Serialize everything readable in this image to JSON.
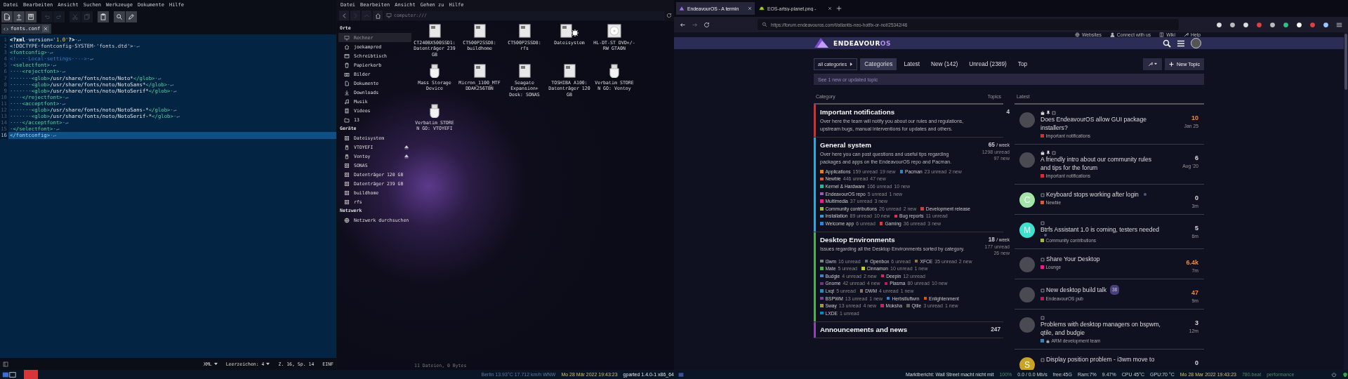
{
  "editor": {
    "menu": [
      "Datei",
      "Bearbeiten",
      "Ansicht",
      "Suchen",
      "Werkzeuge",
      "Dokumente",
      "Hilfe"
    ],
    "toolbar": [
      {
        "kind": "new",
        "disabled": false
      },
      {
        "kind": "open",
        "disabled": false
      },
      {
        "kind": "save",
        "disabled": false
      },
      {
        "kind": "undo",
        "disabled": true
      },
      {
        "kind": "redo",
        "disabled": true
      },
      {
        "kind": "cut",
        "disabled": true
      },
      {
        "kind": "copy",
        "disabled": true
      },
      {
        "kind": "paste",
        "disabled": false
      },
      {
        "kind": "search",
        "disabled": false
      },
      {
        "kind": "edit",
        "disabled": false
      }
    ],
    "tab": {
      "label": "fonts.conf"
    },
    "lines": [
      {
        "number": "1",
        "selected": false,
        "segments": [
          {
            "kind": "decl",
            "text": "<?xml"
          },
          {
            "kind": "ws",
            "text": "·"
          },
          {
            "kind": "text",
            "text": "version="
          },
          {
            "kind": "string",
            "text": "'1.0'"
          },
          {
            "kind": "decl",
            "text": "?>"
          },
          {
            "kind": "ws",
            "text": "·↵"
          }
        ]
      },
      {
        "number": "2",
        "selected": false,
        "segments": [
          {
            "kind": "doctype",
            "text": "<!DOCTYPE·fontconfig·SYSTEM·'fonts.dtd'>"
          },
          {
            "kind": "ws",
            "text": "·↵"
          }
        ]
      },
      {
        "number": "3",
        "selected": false,
        "segments": [
          {
            "kind": "tag",
            "text": "<fontconfig>"
          },
          {
            "kind": "ws",
            "text": "·↵"
          }
        ]
      },
      {
        "number": "4",
        "selected": false,
        "segments": [
          {
            "kind": "comment",
            "text": "<!--··Local·settings··-->"
          },
          {
            "kind": "ws",
            "text": "·↵"
          }
        ]
      },
      {
        "number": "5",
        "selected": false,
        "segments": [
          {
            "kind": "ws",
            "text": "·"
          },
          {
            "kind": "tag",
            "text": "<selectfont>"
          },
          {
            "kind": "ws",
            "text": "·↵"
          }
        ]
      },
      {
        "number": "6",
        "selected": false,
        "segments": [
          {
            "kind": "ws",
            "text": "····"
          },
          {
            "kind": "tag",
            "text": "<rejectfont>"
          },
          {
            "kind": "ws",
            "text": "·↵"
          }
        ]
      },
      {
        "number": "7",
        "selected": false,
        "segments": [
          {
            "kind": "ws",
            "text": "·······"
          },
          {
            "kind": "tag",
            "text": "<glob>"
          },
          {
            "kind": "text",
            "text": "/usr/share/fonts/noto/Noto*"
          },
          {
            "kind": "tag",
            "text": "</glob>"
          },
          {
            "kind": "ws",
            "text": "·↵"
          }
        ]
      },
      {
        "number": "8",
        "selected": false,
        "segments": [
          {
            "kind": "ws",
            "text": "·······"
          },
          {
            "kind": "tag",
            "text": "<glob>"
          },
          {
            "kind": "text",
            "text": "/usr/share/fonts/noto/NotoSans*"
          },
          {
            "kind": "tag",
            "text": "</glob>"
          },
          {
            "kind": "ws",
            "text": "·↵"
          }
        ]
      },
      {
        "number": "9",
        "selected": false,
        "segments": [
          {
            "kind": "ws",
            "text": "·······"
          },
          {
            "kind": "tag",
            "text": "<glob>"
          },
          {
            "kind": "text",
            "text": "/usr/share/fonts/noto/NotoSerif*"
          },
          {
            "kind": "tag",
            "text": "</glob>"
          },
          {
            "kind": "ws",
            "text": "·↵"
          }
        ]
      },
      {
        "number": "10",
        "selected": false,
        "segments": [
          {
            "kind": "ws",
            "text": "····"
          },
          {
            "kind": "tag",
            "text": "</rejectfont>"
          },
          {
            "kind": "ws",
            "text": "·↵"
          }
        ]
      },
      {
        "number": "11",
        "selected": false,
        "segments": [
          {
            "kind": "ws",
            "text": "····"
          },
          {
            "kind": "tag",
            "text": "<acceptfont>"
          },
          {
            "kind": "ws",
            "text": "·↵"
          }
        ]
      },
      {
        "number": "12",
        "selected": false,
        "segments": [
          {
            "kind": "ws",
            "text": "·······"
          },
          {
            "kind": "tag",
            "text": "<glob>"
          },
          {
            "kind": "text",
            "text": "/usr/share/fonts/noto/NotoSans-*"
          },
          {
            "kind": "tag",
            "text": "</glob>"
          },
          {
            "kind": "ws",
            "text": "·↵"
          }
        ]
      },
      {
        "number": "13",
        "selected": false,
        "segments": [
          {
            "kind": "ws",
            "text": "·······"
          },
          {
            "kind": "tag",
            "text": "<glob>"
          },
          {
            "kind": "text",
            "text": "/usr/share/fonts/noto/NotoSerif-*"
          },
          {
            "kind": "tag",
            "text": "</glob>"
          },
          {
            "kind": "ws",
            "text": "·↵"
          }
        ]
      },
      {
        "number": "14",
        "selected": false,
        "segments": [
          {
            "kind": "ws",
            "text": "····"
          },
          {
            "kind": "tag",
            "text": "</acceptfont>"
          },
          {
            "kind": "ws",
            "text": "·↵"
          }
        ]
      },
      {
        "number": "15",
        "selected": false,
        "segments": [
          {
            "kind": "ws",
            "text": "·"
          },
          {
            "kind": "tag",
            "text": "</selectfont>"
          },
          {
            "kind": "ws",
            "text": "·↵"
          }
        ]
      },
      {
        "number": "16",
        "selected": true,
        "segments": [
          {
            "kind": "tag",
            "text": "</fontconfig>"
          },
          {
            "kind": "ws",
            "text": "·↵"
          }
        ]
      }
    ],
    "status_bar": [
      {
        "kind": "dropdown",
        "text": "XML"
      },
      {
        "kind": "dropdown",
        "text": "Leerzeichen: 4"
      },
      {
        "kind": "text",
        "text": "Z. 16, Sp. 14"
      },
      {
        "kind": "text",
        "text": "EINF"
      }
    ]
  },
  "file_manager": {
    "menu": [
      "Datei",
      "Bearbeiten",
      "Ansicht",
      "Gehen zu",
      "Hilfe"
    ],
    "nav": [
      {
        "kind": "back",
        "disabled": false
      },
      {
        "kind": "forward",
        "disabled": true
      },
      {
        "kind": "up",
        "disabled": true
      },
      {
        "kind": "home",
        "disabled": false
      }
    ],
    "address": "computer:///",
    "sidebar": [
      {
        "title": "Orte",
        "items": [
          {
            "label": "Rechner",
            "kind": "computer",
            "selected": true,
            "ejectable": false
          },
          {
            "label": "joekampred",
            "kind": "home",
            "selected": false,
            "ejectable": false
          },
          {
            "label": "Schreibtisch",
            "kind": "desktop",
            "selected": false,
            "ejectable": false
          },
          {
            "label": "Papierkorb",
            "kind": "trash",
            "selected": false,
            "ejectable": false
          },
          {
            "label": "Bilder",
            "kind": "pictures",
            "selected": false,
            "ejectable": false
          },
          {
            "label": "Dokumente",
            "kind": "documents",
            "selected": false,
            "ejectable": false
          },
          {
            "label": "Downloads",
            "kind": "downloads",
            "selected": false,
            "ejectable": false
          },
          {
            "label": "Musik",
            "kind": "music",
            "selected": false,
            "ejectable": false
          },
          {
            "label": "Videos",
            "kind": "videos",
            "selected": false,
            "ejectable": false
          },
          {
            "label": "13",
            "kind": "folder",
            "selected": false,
            "ejectable": false
          }
        ]
      },
      {
        "title": "Geräte",
        "items": [
          {
            "label": "Dateisystem",
            "kind": "drive",
            "selected": false,
            "ejectable": false
          },
          {
            "label": "VTOYEFI",
            "kind": "usb",
            "selected": false,
            "ejectable": true
          },
          {
            "label": "Ventoy",
            "kind": "usb",
            "selected": false,
            "ejectable": true
          },
          {
            "label": "SONAS",
            "kind": "drive",
            "selected": false,
            "ejectable": false
          },
          {
            "label": "Datenträger 120 GB",
            "kind": "drive",
            "selected": false,
            "ejectable": false
          },
          {
            "label": "Datenträger 239 GB",
            "kind": "drive",
            "selected": false,
            "ejectable": false
          },
          {
            "label": "buildhome",
            "kind": "drive",
            "selected": false,
            "ejectable": false
          },
          {
            "label": "rfs",
            "kind": "drive",
            "selected": false,
            "ejectable": false
          }
        ]
      },
      {
        "title": "Netzwerk",
        "items": [
          {
            "label": "Netzwerk durchsuchen",
            "kind": "network",
            "selected": false,
            "ejectable": false
          }
        ]
      }
    ],
    "items": [
      {
        "label": "CT240BX500SSD1: Datenträger 239 GB",
        "kind": "drive"
      },
      {
        "label": "CT500P2SSD8: buildhome",
        "kind": "drive"
      },
      {
        "label": "CT500P2SSD8: rfs",
        "kind": "drive"
      },
      {
        "label": "Dateisystem",
        "kind": "filesystem"
      },
      {
        "label": "HL-DT-ST DVD+/-RW GTA0N",
        "kind": "optical"
      },
      {
        "label": "Mass Storage Device",
        "kind": "usb"
      },
      {
        "label": "Micron_1100_MTFDDAK256TBN",
        "kind": "drive"
      },
      {
        "label": "Seagate Expansion+ Desk: SONAS",
        "kind": "drive"
      },
      {
        "label": "TOSHIBA A100: Datenträger 120 GB",
        "kind": "drive"
      },
      {
        "label": "Verbatim STORE N GO: Ventoy",
        "kind": "usb"
      },
      {
        "label": "Verbatim STORE N GO: VTOYEFI",
        "kind": "usb"
      }
    ],
    "status_bar": "11 Dateien, 0 Bytes"
  },
  "browser": {
    "tabs": [
      {
        "title": "EndeavourOS - A termin",
        "kind": "forum",
        "selected": true
      },
      {
        "title": "EOS-artsy-planet.png -",
        "kind": "image",
        "selected": false
      }
    ],
    "url": "https://forum.endeavouros.com/t/atlantis-neo-hotfix-or-not/25342/46",
    "forum": {
      "top_links": [
        {
          "label": "Websites",
          "kind": "globe"
        },
        {
          "label": "Connect with us",
          "kind": "user"
        },
        {
          "label": "Wiki",
          "kind": "book"
        },
        {
          "label": "Help",
          "kind": "wrench"
        }
      ],
      "logo": {
        "text": "ENDEAVOUR",
        "accent": "OS"
      },
      "category_dropdown": "all categories",
      "nav": [
        {
          "label": "Categories",
          "selected": true
        },
        {
          "label": "Latest",
          "selected": false
        },
        {
          "label": "New (142)",
          "selected": false
        },
        {
          "label": "Unread (2389)",
          "selected": false
        },
        {
          "label": "Top",
          "selected": false
        }
      ],
      "new_topic": "New Topic",
      "banner": "See 1 new or updated topic",
      "category_heading": "Category",
      "topics_heading": "Topics",
      "latest_heading": "Latest",
      "categories": [
        {
          "name": "Important notifications",
          "color": "#d32f2f",
          "description": "Over here the team will notify you about our rules and regulations, upstream bugs, manual interventions for updates and others.",
          "count": "4"
        },
        {
          "name": "General system",
          "color": "#25aae2",
          "description": "Over here you can post questions and useful tips regarding packages and apps on the EndeavourOS repo and Pacman.",
          "count": "65",
          "period": "/ week",
          "unread": "1298 unread",
          "new": "97 new",
          "subcategories": [
            [
              {
                "name": "Applications",
                "color": "#e67e22",
                "unread": "159 unread",
                "new": "19 new"
              },
              {
                "name": "Pacman",
                "color": "#2e86c1",
                "unread": "23 unread",
                "new": "2 new"
              }
            ],
            [
              {
                "name": "Newbie",
                "color": "#e2582d",
                "unread": "446 unread",
                "new": "47 new"
              }
            ],
            [
              {
                "name": "Kernel & Hardware",
                "color": "#1abc9c",
                "unread": "166 unread",
                "new": "10 new"
              }
            ],
            [
              {
                "name": "EndeavourOS repo",
                "color": "#9b59b6",
                "unread": "5 unread",
                "new": "1 new"
              }
            ],
            [
              {
                "name": "Multimedia",
                "color": "#e91e8c",
                "unread": "37 unread",
                "new": "3 new"
              }
            ],
            [
              {
                "name": "Community contributions",
                "color": "#a4b93a",
                "unread": "26 unread",
                "new": "2 new"
              },
              {
                "name": "Development release",
                "color": "#d63a3a"
              }
            ],
            [
              {
                "name": "Installation",
                "color": "#3498db",
                "unread": "89 unread",
                "new": "10 new"
              },
              {
                "name": "Bug reports",
                "color": "#e0314b",
                "unread": "11 unread"
              }
            ],
            [
              {
                "name": "Welcome app",
                "color": "#1e88e5",
                "unread": "6 unread"
              },
              {
                "name": "Gaming",
                "color": "#e53935",
                "unread": "36 unread",
                "new": "3 new"
              }
            ]
          ]
        },
        {
          "name": "Desktop Environments",
          "color": "#4caf50",
          "description": "Issues regarding all the Desktop Environments sorted by category.",
          "count": "18",
          "period": "/ week",
          "unread": "177 unread",
          "new": "26 new",
          "subcategories": [
            [
              {
                "name": "i3wm",
                "color": "#808080",
                "unread": "16 unread"
              },
              {
                "name": "Openbox",
                "color": "#5d6d7e",
                "unread": "6 unread"
              },
              {
                "name": "XFCE",
                "color": "#a0713c",
                "unread": "35 unread",
                "new": "2 new"
              }
            ],
            [
              {
                "name": "Mate",
                "color": "#4caf50",
                "unread": "5 unread"
              },
              {
                "name": "Cinnamon",
                "color": "#c0ca33",
                "unread": "10 unread",
                "new": "1 new"
              }
            ],
            [
              {
                "name": "Budgie",
                "color": "#3f7fd9",
                "unread": "4 unread",
                "new": "2 new"
              },
              {
                "name": "Deepin",
                "color": "#e91e63",
                "unread": "12 unread"
              }
            ],
            [
              {
                "name": "Gnome",
                "color": "#6c3483",
                "unread": "42 unread",
                "new": "4 new"
              },
              {
                "name": "Plasma",
                "color": "#c2185b",
                "unread": "80 unread",
                "new": "10 new"
              }
            ],
            [
              {
                "name": "Lxqt",
                "color": "#2e86c1",
                "unread": "5 unread"
              },
              {
                "name": "DWM",
                "color": "#8d6e63",
                "unread": "4 unread",
                "new": "1 new"
              }
            ],
            [
              {
                "name": "BSPWM",
                "color": "#7b3fa0",
                "unread": "13 unread",
                "new": "1 new"
              },
              {
                "name": "Herbstluftwm",
                "color": "#1e88e5"
              },
              {
                "name": "Enlightenment",
                "color": "#e65100"
              }
            ],
            [
              {
                "name": "Sway",
                "color": "#9e9d24",
                "unread": "13 unread",
                "new": "4 new"
              },
              {
                "name": "Moksha",
                "color": "#d81b60"
              },
              {
                "name": "Qtile",
                "color": "#616161",
                "unread": "3 unread",
                "new": "1 new"
              }
            ],
            [
              {
                "name": "LXDE",
                "color": "#0288d1",
                "unread": "1 unread"
              }
            ]
          ]
        },
        {
          "name": "Announcements and news",
          "color": "#8e44ad",
          "count": "247"
        }
      ],
      "latest": [
        {
          "avatar": {
            "kind": "photo"
          },
          "locked": true,
          "pinned": true,
          "unread_dot": false,
          "title": "Does EndeavourOS allow GUI package installers?",
          "category": {
            "name": "Important notifications",
            "color": "#d32f2f",
            "locked": false
          },
          "count": "10",
          "hot": true,
          "time": "Jan 25"
        },
        {
          "avatar": {
            "kind": "photo"
          },
          "locked": true,
          "pinned": true,
          "unread_dot": false,
          "title": "A friendly intro about our community rules and tips for the forum",
          "category": {
            "name": "Important notifications",
            "color": "#d32f2f",
            "locked": false
          },
          "count": "6",
          "hot": false,
          "time": "Aug '20"
        },
        {
          "avatar": {
            "kind": "letter",
            "letter": "C",
            "color": "#a3e4a8"
          },
          "locked": false,
          "pinned": false,
          "unread_dot": true,
          "title": "Keyboard stops working after login",
          "category": {
            "name": "Newbie",
            "color": "#e2582d",
            "locked": false
          },
          "count": "0",
          "hot": false,
          "time": "3m"
        },
        {
          "avatar": {
            "kind": "letter",
            "letter": "M",
            "color": "#3ee0d0"
          },
          "locked": false,
          "pinned": false,
          "unread_dot": true,
          "title": "Btrfs Assistant 1.0 is coming, testers needed",
          "category": {
            "name": "Community contributions",
            "color": "#a4b93a",
            "locked": false
          },
          "count": "5",
          "hot": false,
          "time": "6m"
        },
        {
          "avatar": {
            "kind": "photo"
          },
          "locked": false,
          "pinned": false,
          "unread_dot": false,
          "title": "Share Your Desktop",
          "category": {
            "name": "Lounge",
            "color": "#e91e8c",
            "locked": false
          },
          "count": "6.4k",
          "hot": true,
          "time": "7m"
        },
        {
          "avatar": {
            "kind": "photo"
          },
          "locked": false,
          "pinned": false,
          "unread_dot": false,
          "badge": "38",
          "title": "New desktop build talk",
          "category": {
            "name": "EndeavourOS pub",
            "color": "#c2185b",
            "locked": false
          },
          "count": "47",
          "hot": true,
          "time": "9m"
        },
        {
          "avatar": {
            "kind": "photo"
          },
          "locked": false,
          "pinned": false,
          "unread_dot": false,
          "title": "Problems with desktop managers on bspwm, qtile, and budgie",
          "category": {
            "name": "ARM development team",
            "color": "#2e86c1",
            "locked": true
          },
          "count": "3",
          "hot": false,
          "time": "12m"
        },
        {
          "avatar": {
            "kind": "letter",
            "letter": "S",
            "color": "#c9a227"
          },
          "locked": false,
          "pinned": false,
          "unread_dot": false,
          "title": "Display position problem - i3wm move to",
          "count": "0",
          "hot": false
        }
      ]
    }
  },
  "taskbar": {
    "left": [
      {
        "text": "Berlin 13.93°C 17.712 km/h WNW",
        "kind": "weather"
      },
      {
        "text": "Mo 28 Mär 2022 19:43:23",
        "kind": "clock"
      },
      {
        "text": "gparted 1.4.0-1 x86_64",
        "kind": "update"
      }
    ],
    "right": [
      {
        "text": "Marktbericht: Wall Street macht nicht mit",
        "kind": "news"
      },
      {
        "text": "100%",
        "kind": "dim"
      },
      {
        "text": "0.0 / 0.0 Mb/s",
        "kind": "plain"
      },
      {
        "text": "free:45G",
        "kind": "plain"
      },
      {
        "text": "Ram:7%",
        "kind": "plain"
      },
      {
        "text": "9.47%",
        "kind": "plain"
      },
      {
        "text": "CPU 45°C",
        "kind": "plain"
      },
      {
        "text": "GPU:70 °C",
        "kind": "plain"
      },
      {
        "text": "Mo 28 Mar 2022 19:43:23",
        "kind": "clock"
      },
      {
        "text": "780.beat",
        "kind": "dim"
      },
      {
        "text": "performance",
        "kind": "dim"
      }
    ]
  }
}
